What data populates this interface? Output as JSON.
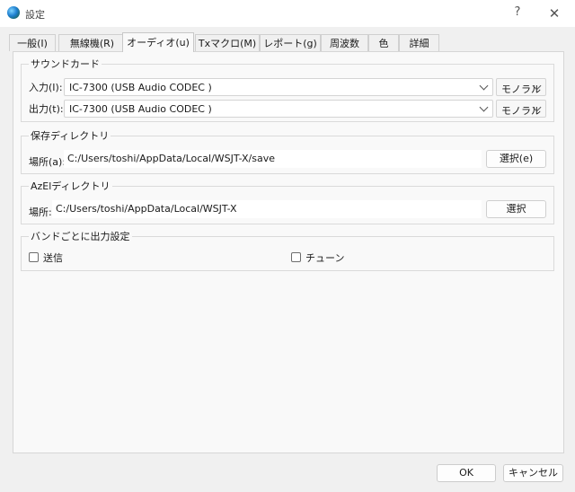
{
  "window": {
    "title": "設定",
    "help": "?",
    "close": "✕"
  },
  "tabs": [
    {
      "label": "一般(I)"
    },
    {
      "label": "無線機(R)"
    },
    {
      "label": "オーディオ(u)"
    },
    {
      "label": "Txマクロ(M)"
    },
    {
      "label": "レポート(g)"
    },
    {
      "label": "周波数"
    },
    {
      "label": "色"
    },
    {
      "label": "詳細"
    }
  ],
  "active_tab": "オーディオ(u)",
  "soundcard": {
    "title": "サウンドカード",
    "input": {
      "label": "入力(I):",
      "device": "IC-7300 (USB Audio CODEC )",
      "channel": "モノラル"
    },
    "output": {
      "label": "出力(t):",
      "device": "IC-7300 (USB Audio CODEC )",
      "channel": "モノラル"
    }
  },
  "save_dir": {
    "title": "保存ディレクトリ",
    "label": "場所(a):",
    "path": "C:/Users/toshi/AppData/Local/WSJT-X/save",
    "button": "選択(e)"
  },
  "azel_dir": {
    "title": "AzElディレクトリ",
    "label": "場所:",
    "path": "C:/Users/toshi/AppData/Local/WSJT-X",
    "button": "選択"
  },
  "band_output": {
    "title": "バンドごとに出力設定",
    "transmit": {
      "label": "送信",
      "checked": false
    },
    "tune": {
      "label": "チューン",
      "checked": false
    }
  },
  "footer": {
    "ok": "OK",
    "cancel": "キャンセル"
  }
}
